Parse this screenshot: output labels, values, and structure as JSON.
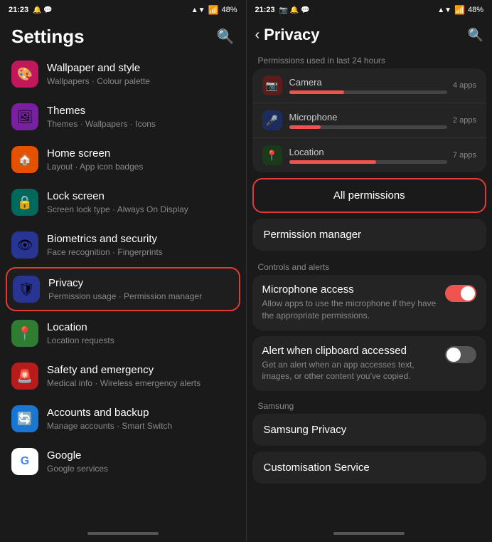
{
  "left": {
    "statusBar": {
      "time": "21:23",
      "icons": "🔔 💬 📧",
      "signal": "WiFi",
      "battery": "48%"
    },
    "title": "Settings",
    "searchIcon": "🔍",
    "items": [
      {
        "id": "wallpaper",
        "icon": "🎨",
        "iconClass": "icon-pink",
        "title": "Wallpaper and style",
        "subtitle": "Wallpapers · Colour palette"
      },
      {
        "id": "themes",
        "icon": "🖼",
        "iconClass": "icon-purple",
        "title": "Themes",
        "subtitle": "Themes · Wallpapers · Icons"
      },
      {
        "id": "home-screen",
        "icon": "🏠",
        "iconClass": "icon-orange-dark",
        "title": "Home screen",
        "subtitle": "Layout · App icon badges"
      },
      {
        "id": "lock-screen",
        "icon": "🔒",
        "iconClass": "icon-teal",
        "title": "Lock screen",
        "subtitle": "Screen lock type · Always On Display"
      },
      {
        "id": "biometrics",
        "icon": "👁",
        "iconClass": "icon-indigo",
        "title": "Biometrics and security",
        "subtitle": "Face recognition · Fingerprints"
      },
      {
        "id": "privacy",
        "icon": "🛡",
        "iconClass": "icon-indigo",
        "title": "Privacy",
        "subtitle": "Permission usage · Permission manager",
        "highlighted": true
      },
      {
        "id": "location",
        "icon": "📍",
        "iconClass": "icon-green",
        "title": "Location",
        "subtitle": "Location requests"
      },
      {
        "id": "safety",
        "icon": "🚨",
        "iconClass": "icon-red-dark",
        "title": "Safety and emergency",
        "subtitle": "Medical info · Wireless emergency alerts"
      },
      {
        "id": "accounts",
        "icon": "🔄",
        "iconClass": "icon-blue",
        "title": "Accounts and backup",
        "subtitle": "Manage accounts · Smart Switch"
      },
      {
        "id": "google",
        "icon": "G",
        "iconClass": "icon-google",
        "title": "Google",
        "subtitle": "Google services"
      }
    ]
  },
  "right": {
    "statusBar": {
      "time": "21:23",
      "icons": "📷 🔔 💬",
      "signal": "WiFi",
      "battery": "48%"
    },
    "backIcon": "‹",
    "title": "Privacy",
    "searchIcon": "🔍",
    "permissionsSection": {
      "label": "Permissions used in last 24 hours",
      "items": [
        {
          "id": "camera",
          "icon": "📷",
          "iconClass": "perm-icon-cam",
          "name": "Camera",
          "count": "4 apps",
          "fillPercent": 35
        },
        {
          "id": "microphone",
          "icon": "🎤",
          "iconClass": "perm-icon-mic",
          "name": "Microphone",
          "count": "2 apps",
          "fillPercent": 20
        },
        {
          "id": "location",
          "icon": "📍",
          "iconClass": "perm-icon-loc",
          "name": "Location",
          "count": "7 apps",
          "fillPercent": 55
        }
      ],
      "allPermissionsLabel": "All permissions"
    },
    "permissionManagerLabel": "Permission manager",
    "controlsSection": {
      "label": "Controls and alerts",
      "items": [
        {
          "id": "mic-access",
          "title": "Microphone access",
          "subtitle": "Allow apps to use the microphone if they have the appropriate permissions.",
          "toggleOn": true
        },
        {
          "id": "clipboard",
          "title": "Alert when clipboard accessed",
          "subtitle": "Get an alert when an app accesses text, images, or other content you've copied.",
          "toggleOn": false
        }
      ]
    },
    "samsungSection": {
      "label": "Samsung",
      "items": [
        {
          "id": "samsung-privacy",
          "title": "Samsung Privacy"
        },
        {
          "id": "customisation",
          "title": "Customisation Service"
        }
      ]
    }
  }
}
